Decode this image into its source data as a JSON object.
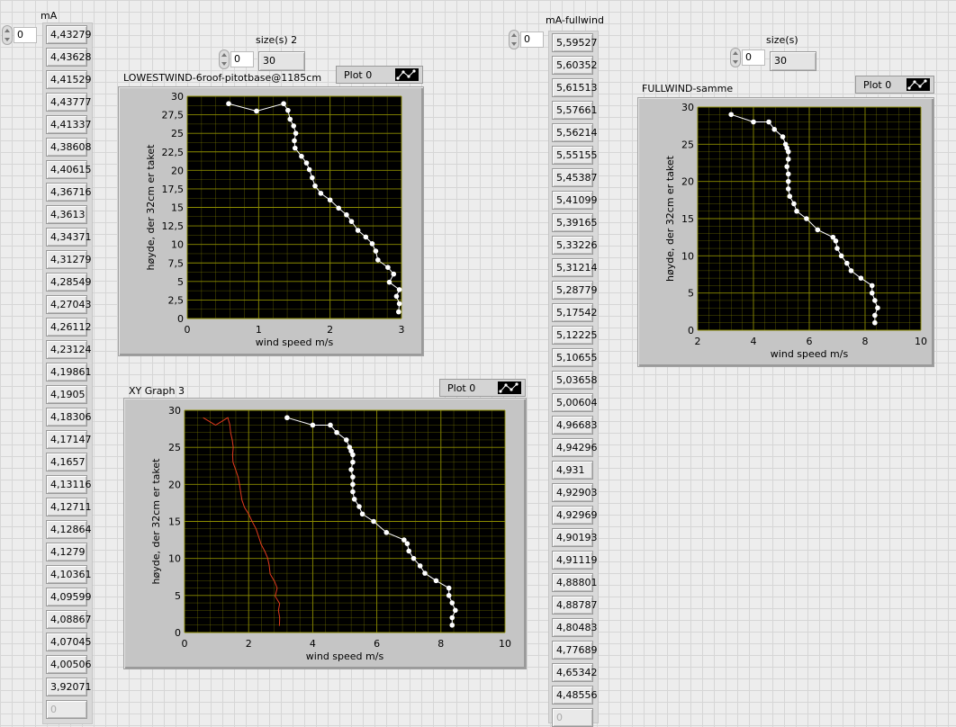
{
  "left_array": {
    "title": "mA",
    "index": "0",
    "values": [
      "4,43279",
      "4,43628",
      "4,41529",
      "4,43777",
      "4,41337",
      "4,38608",
      "4,40615",
      "4,36716",
      "4,3613",
      "4,34371",
      "4,31279",
      "4,28549",
      "4,27043",
      "4,26112",
      "4,23124",
      "4,19861",
      "4,1905",
      "4,18306",
      "4,17147",
      "4,1657",
      "4,13116",
      "4,12711",
      "4,12864",
      "4,1279",
      "4,10361",
      "4,09599",
      "4,08867",
      "4,07045",
      "4,00506",
      "3,92071",
      "0"
    ]
  },
  "mid_array": {
    "title": "mA-fullwind",
    "index": "0",
    "values": [
      "5,59527",
      "5,60352",
      "5,61513",
      "5,57661",
      "5,56214",
      "5,55155",
      "5,45387",
      "5,41099",
      "5,39165",
      "5,33226",
      "5,31214",
      "5,28779",
      "5,17542",
      "5,12225",
      "5,10655",
      "5,03658",
      "5,00604",
      "4,96683",
      "4,94296",
      "4,931",
      "4,92903",
      "4,92969",
      "4,90193",
      "4,91119",
      "4,88801",
      "4,88787",
      "4,80483",
      "4,77689",
      "4,65342",
      "4,48556",
      "0"
    ]
  },
  "size_controls": {
    "left_label": "size(s) 2",
    "left_index": "0",
    "left_value": "30",
    "right_label": "size(s)",
    "right_index": "0",
    "right_value": "30"
  },
  "graph1": {
    "title": "LOWESTWIND-6roof-pitotbase@1185cm",
    "legend": "Plot 0"
  },
  "graph2": {
    "title": "FULLWIND-samme",
    "legend": "Plot 0"
  },
  "graph3": {
    "title": "XY Graph 3",
    "legend": "Plot 0"
  },
  "colors": {
    "plot_bg": "#000000",
    "grid": "#8c8c00",
    "series_white": "#ffffff",
    "series_red": "#e03a1e"
  },
  "chart_data": [
    {
      "type": "scatter",
      "title": "LOWESTWIND-6roof-pitotbase@1185cm",
      "xlabel": "wind speed m/s",
      "ylabel": "høyde, der 32cm er taket",
      "xlim": [
        0,
        3
      ],
      "ylim": [
        0,
        30
      ],
      "xticks": [
        "0",
        "1",
        "2",
        "3"
      ],
      "yticks": [
        "0",
        "2,5",
        "5",
        "7,5",
        "10",
        "12,5",
        "15",
        "17,5",
        "20",
        "22,5",
        "25",
        "27,5",
        "30"
      ],
      "grid": true,
      "series": [
        {
          "name": "Plot 0",
          "color": "#ffffff",
          "markers": true,
          "x": [
            2.96,
            2.97,
            2.93,
            2.97,
            2.83,
            2.89,
            2.81,
            2.67,
            2.64,
            2.59,
            2.5,
            2.39,
            2.3,
            2.23,
            2.12,
            2.0,
            1.87,
            1.79,
            1.75,
            1.71,
            1.67,
            1.6,
            1.51,
            1.5,
            1.52,
            1.49,
            1.44,
            1.41,
            1.35,
            0.97,
            0.58
          ],
          "y": [
            0.9,
            2.0,
            3.0,
            3.9,
            4.9,
            6.0,
            6.9,
            7.9,
            9.1,
            10.1,
            11.0,
            11.9,
            13.1,
            14.0,
            14.9,
            16.0,
            16.9,
            17.9,
            19.0,
            20.1,
            21.0,
            21.9,
            23.0,
            24.0,
            25.0,
            26.0,
            26.9,
            28.1,
            29.0,
            28.0,
            29.0
          ]
        }
      ]
    },
    {
      "type": "scatter",
      "title": "FULLWIND-samme",
      "xlabel": "wind speed m/s",
      "ylabel": "høyde, der 32cm er taket",
      "xlim": [
        2,
        10
      ],
      "ylim": [
        0,
        30
      ],
      "xticks": [
        "2",
        "4",
        "6",
        "8",
        "10"
      ],
      "yticks": [
        "0",
        "5",
        "10",
        "15",
        "20",
        "25",
        "30"
      ],
      "grid": true,
      "series": [
        {
          "name": "Plot 0",
          "color": "#ffffff",
          "markers": true,
          "x": [
            8.35,
            8.35,
            8.45,
            8.35,
            8.25,
            8.25,
            7.85,
            7.5,
            7.35,
            7.15,
            7.0,
            6.95,
            6.85,
            6.3,
            5.9,
            5.55,
            5.45,
            5.3,
            5.25,
            5.25,
            5.25,
            5.2,
            5.25,
            5.25,
            5.2,
            5.15,
            5.05,
            4.75,
            4.55,
            4.0,
            3.2
          ],
          "y": [
            1,
            2,
            3,
            4,
            5,
            6,
            7,
            8,
            9,
            10,
            11,
            12,
            12.5,
            13.5,
            15,
            16,
            17,
            18,
            19,
            20,
            21,
            22,
            23,
            24,
            24.5,
            25,
            26,
            27,
            28,
            28,
            29
          ]
        }
      ]
    },
    {
      "type": "line",
      "title": "XY Graph 3",
      "xlabel": "wind speed m/s",
      "ylabel": "høyde, der 32cm er taket",
      "xlim": [
        0,
        10
      ],
      "ylim": [
        0,
        30
      ],
      "xticks": [
        "0",
        "2",
        "4",
        "6",
        "8",
        "10"
      ],
      "yticks": [
        "0",
        "5",
        "10",
        "15",
        "20",
        "25",
        "30"
      ],
      "grid": true,
      "series": [
        {
          "name": "Plot 0",
          "color": "#ffffff",
          "markers": true,
          "x": [
            8.35,
            8.35,
            8.45,
            8.35,
            8.25,
            8.25,
            7.85,
            7.5,
            7.35,
            7.15,
            7.0,
            6.95,
            6.85,
            6.3,
            5.9,
            5.55,
            5.45,
            5.3,
            5.25,
            5.25,
            5.25,
            5.2,
            5.25,
            5.25,
            5.2,
            5.15,
            5.05,
            4.75,
            4.55,
            4.0,
            3.2
          ],
          "y": [
            1,
            2,
            3,
            4,
            5,
            6,
            7,
            8,
            9,
            10,
            11,
            12,
            12.5,
            13.5,
            15,
            16,
            17,
            18,
            19,
            20,
            21,
            22,
            23,
            24,
            24.5,
            25,
            26,
            27,
            28,
            28,
            29
          ]
        },
        {
          "color": "#e03a1e",
          "markers": false,
          "x": [
            2.96,
            2.97,
            2.93,
            2.97,
            2.83,
            2.89,
            2.81,
            2.67,
            2.64,
            2.59,
            2.5,
            2.39,
            2.3,
            2.23,
            2.12,
            2.0,
            1.87,
            1.79,
            1.75,
            1.71,
            1.67,
            1.6,
            1.51,
            1.5,
            1.52,
            1.49,
            1.44,
            1.41,
            1.35,
            0.97,
            0.58
          ],
          "y": [
            0.9,
            2.0,
            3.0,
            3.9,
            4.9,
            6.0,
            6.9,
            7.9,
            9.1,
            10.1,
            11.0,
            11.9,
            13.1,
            14.0,
            14.9,
            16.0,
            16.9,
            17.9,
            19.0,
            20.1,
            21.0,
            21.9,
            23.0,
            24.0,
            25.0,
            26.0,
            26.9,
            28.1,
            29.0,
            28.0,
            29.0
          ]
        }
      ]
    }
  ]
}
